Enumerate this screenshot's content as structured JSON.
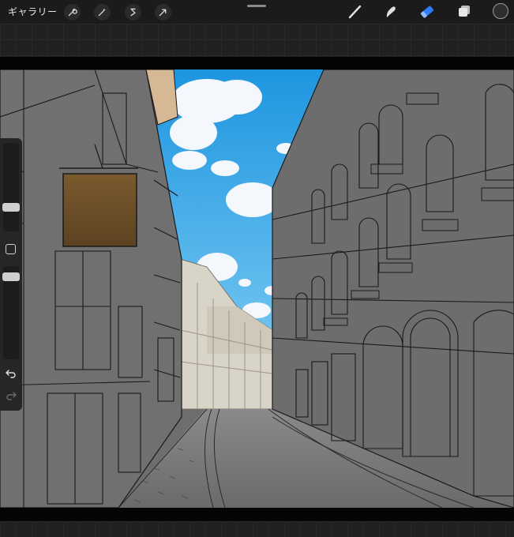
{
  "toolbar": {
    "gallery_label": "ギャラリー",
    "left_tools": [
      "wrench-icon",
      "magic-wand-icon",
      "selection-icon",
      "transform-arrow-icon"
    ],
    "right_tools": [
      "brush-icon",
      "smudge-icon",
      "eraser-icon",
      "layers-icon"
    ],
    "active_tool": "eraser-icon",
    "active_color": "#2e2e2e",
    "accent_color": "#2f7df6"
  },
  "sidebar": {
    "brush_size_level": 0.35,
    "opacity_level": 0.15,
    "buttons": [
      "modify-square-icon",
      "undo-icon",
      "redo-icon"
    ]
  },
  "canvas": {
    "artwork": "street-illustration",
    "sign_color": "#7a5a2e",
    "sky_color": "#2aa3e6"
  }
}
